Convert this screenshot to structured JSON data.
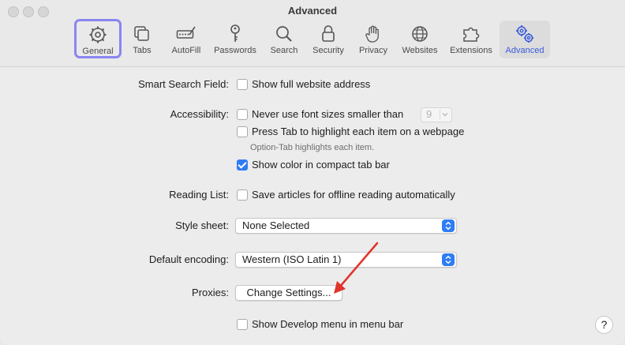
{
  "window": {
    "title": "Advanced"
  },
  "toolbar": {
    "tabs": [
      {
        "label": "General",
        "icon": "gear-icon"
      },
      {
        "label": "Tabs",
        "icon": "tabs-icon"
      },
      {
        "label": "AutoFill",
        "icon": "autofill-icon"
      },
      {
        "label": "Passwords",
        "icon": "key-icon"
      },
      {
        "label": "Search",
        "icon": "search-icon"
      },
      {
        "label": "Security",
        "icon": "lock-icon"
      },
      {
        "label": "Privacy",
        "icon": "hand-icon"
      },
      {
        "label": "Websites",
        "icon": "globe-icon"
      },
      {
        "label": "Extensions",
        "icon": "puzzle-icon"
      },
      {
        "label": "Advanced",
        "icon": "gears-icon"
      }
    ],
    "selected": "Advanced",
    "focused": "General",
    "accent": "#3b5bdb"
  },
  "settings": {
    "smart_search": {
      "label": "Smart Search Field:",
      "option": "Show full website address",
      "checked": false
    },
    "accessibility": {
      "label": "Accessibility:",
      "font_option": "Never use font sizes smaller than",
      "font_size": "9",
      "tab_option": "Press Tab to highlight each item on a webpage",
      "tab_hint": "Option-Tab highlights each item.",
      "color_option": "Show color in compact tab bar"
    },
    "reading_list": {
      "label": "Reading List:",
      "option": "Save articles for offline reading automatically"
    },
    "style_sheet": {
      "label": "Style sheet:",
      "value": "None Selected"
    },
    "encoding": {
      "label": "Default encoding:",
      "value": "Western (ISO Latin 1)"
    },
    "proxies": {
      "label": "Proxies:",
      "button": "Change Settings..."
    },
    "develop": {
      "option": "Show Develop menu in menu bar"
    },
    "help": "?"
  },
  "colors": {
    "checkbox_checked": "#2f7cf6",
    "annotation_arrow": "#e0342c"
  }
}
